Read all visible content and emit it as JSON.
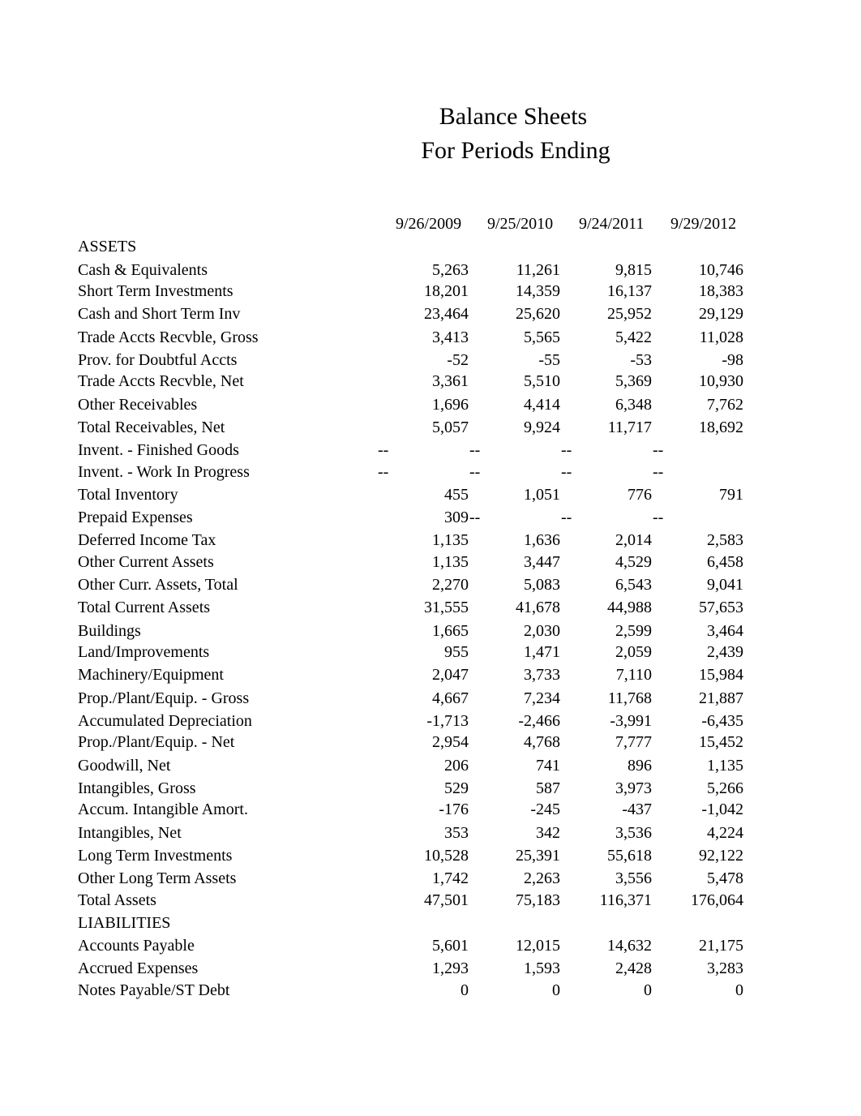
{
  "document": {
    "title": "Balance Sheets",
    "subtitle": "For Periods Ending"
  },
  "columns": [
    "9/26/2009",
    "9/25/2010",
    "9/24/2011",
    "9/29/2012"
  ],
  "rows": [
    {
      "label": "ASSETS",
      "section": true,
      "values": []
    },
    {
      "label": "Cash & Equivalents",
      "values": [
        "5,263",
        "11,261",
        "9,815",
        "10,746"
      ]
    },
    {
      "label": "Short Term Investments",
      "values": [
        "18,201",
        "14,359",
        "16,137",
        "18,383"
      ]
    },
    {
      "label": "Cash and Short Term Inv",
      "values": [
        "23,464",
        "25,620",
        "25,952",
        "29,129"
      ]
    },
    {
      "label": "Trade Accts Recvble, Gross",
      "values": [
        "3,413",
        "5,565",
        "5,422",
        "11,028"
      ]
    },
    {
      "label": "Prov. for Doubtful Accts",
      "values": [
        "-52",
        "-55",
        "-53",
        "-98"
      ]
    },
    {
      "label": "Trade Accts Recvble, Net",
      "values": [
        "3,361",
        "5,510",
        "5,369",
        "10,930"
      ]
    },
    {
      "label": "Other Receivables",
      "values": [
        "1,696",
        "4,414",
        "6,348",
        "7,762"
      ]
    },
    {
      "label": "Total Receivables, Net",
      "values": [
        "5,057",
        "9,924",
        "11,717",
        "18,692"
      ]
    },
    {
      "label": "Invent. - Finished Goods",
      "values": [
        "--",
        "--",
        "--",
        "--"
      ]
    },
    {
      "label": "Invent. - Work In Progress",
      "values": [
        "--",
        "--",
        "--",
        "--"
      ]
    },
    {
      "label": "Total Inventory",
      "values": [
        "455",
        "1,051",
        "776",
        "791"
      ]
    },
    {
      "label": "Prepaid Expenses",
      "values": [
        "309",
        "--",
        "--",
        "--"
      ]
    },
    {
      "label": "Deferred Income Tax",
      "values": [
        "1,135",
        "1,636",
        "2,014",
        "2,583"
      ]
    },
    {
      "label": "Other Current Assets",
      "values": [
        "1,135",
        "3,447",
        "4,529",
        "6,458"
      ]
    },
    {
      "label": "Other Curr. Assets, Total",
      "values": [
        "2,270",
        "5,083",
        "6,543",
        "9,041"
      ]
    },
    {
      "label": "Total Current Assets",
      "values": [
        "31,555",
        "41,678",
        "44,988",
        "57,653"
      ]
    },
    {
      "label": "Buildings",
      "values": [
        "1,665",
        "2,030",
        "2,599",
        "3,464"
      ]
    },
    {
      "label": "Land/Improvements",
      "values": [
        "955",
        "1,471",
        "2,059",
        "2,439"
      ]
    },
    {
      "label": "Machinery/Equipment",
      "values": [
        "2,047",
        "3,733",
        "7,110",
        "15,984"
      ]
    },
    {
      "label": "Prop./Plant/Equip. - Gross",
      "values": [
        "4,667",
        "7,234",
        "11,768",
        "21,887"
      ]
    },
    {
      "label": "Accumulated Depreciation",
      "values": [
        "-1,713",
        "-2,466",
        "-3,991",
        "-6,435"
      ]
    },
    {
      "label": "Prop./Plant/Equip. - Net",
      "values": [
        "2,954",
        "4,768",
        "7,777",
        "15,452"
      ]
    },
    {
      "label": "Goodwill, Net",
      "values": [
        "206",
        "741",
        "896",
        "1,135"
      ]
    },
    {
      "label": "Intangibles, Gross",
      "values": [
        "529",
        "587",
        "3,973",
        "5,266"
      ]
    },
    {
      "label": "Accum. Intangible Amort.",
      "values": [
        "-176",
        "-245",
        "-437",
        "-1,042"
      ]
    },
    {
      "label": "Intangibles, Net",
      "values": [
        "353",
        "342",
        "3,536",
        "4,224"
      ]
    },
    {
      "label": "Long Term Investments",
      "values": [
        "10,528",
        "25,391",
        "55,618",
        "92,122"
      ]
    },
    {
      "label": "Other Long Term Assets",
      "values": [
        "1,742",
        "2,263",
        "3,556",
        "5,478"
      ]
    },
    {
      "label": "Total Assets",
      "values": [
        "47,501",
        "75,183",
        "116,371",
        "176,064"
      ]
    },
    {
      "label": "LIABILITIES",
      "section": true,
      "values": []
    },
    {
      "label": "Accounts Payable",
      "values": [
        "5,601",
        "12,015",
        "14,632",
        "21,175"
      ]
    },
    {
      "label": "Accrued Expenses",
      "values": [
        "1,293",
        "1,593",
        "2,428",
        "3,283"
      ]
    },
    {
      "label": "Notes Payable/ST Debt",
      "values": [
        "0",
        "0",
        "0",
        "0"
      ]
    }
  ]
}
